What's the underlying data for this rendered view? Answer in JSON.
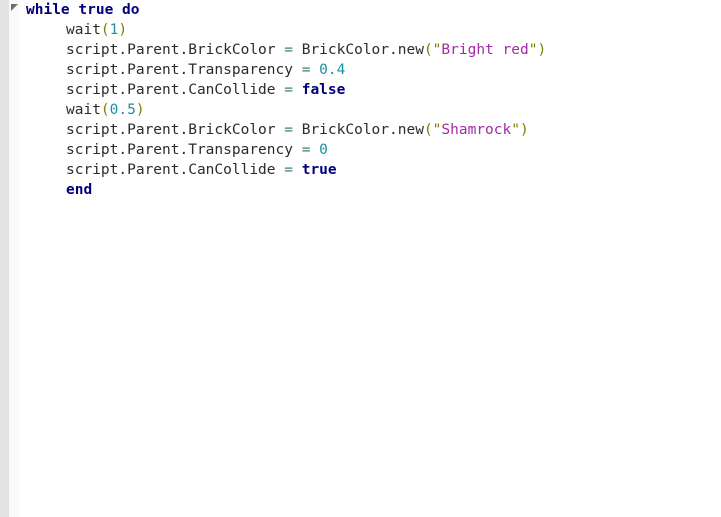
{
  "editor": {
    "language": "Lua",
    "gutter": {
      "fold_marker": "collapse-triangle"
    },
    "colors": {
      "keyword": "#00007f",
      "string": "#a52aa5",
      "number": "#1a8fa0",
      "punctuation": "#7f7f00",
      "operator": "#3f7f7f",
      "plain_text": "#2b2b2b",
      "background": "#ffffff",
      "gutter_band": "#e3e3e3",
      "gutter_strip": "#fafafa"
    },
    "lines": [
      {
        "indent": 0,
        "tokens": [
          {
            "t": "while",
            "c": "kw"
          },
          {
            "t": " ",
            "c": "plain"
          },
          {
            "t": "true",
            "c": "kw"
          },
          {
            "t": " ",
            "c": "plain"
          },
          {
            "t": "do",
            "c": "kw"
          }
        ]
      },
      {
        "indent": 1,
        "tokens": [
          {
            "t": "wait",
            "c": "plain"
          },
          {
            "t": "(",
            "c": "punct"
          },
          {
            "t": "1",
            "c": "num"
          },
          {
            "t": ")",
            "c": "punct"
          }
        ]
      },
      {
        "indent": 1,
        "tokens": [
          {
            "t": "script.Parent.BrickColor ",
            "c": "plain"
          },
          {
            "t": "=",
            "c": "op"
          },
          {
            "t": " BrickColor.new",
            "c": "plain"
          },
          {
            "t": "(",
            "c": "punct"
          },
          {
            "t": "\"",
            "c": "punct"
          },
          {
            "t": "Bright red",
            "c": "str"
          },
          {
            "t": "\"",
            "c": "punct"
          },
          {
            "t": ")",
            "c": "punct"
          }
        ]
      },
      {
        "indent": 1,
        "tokens": [
          {
            "t": "script.Parent.Transparency ",
            "c": "plain"
          },
          {
            "t": "=",
            "c": "op"
          },
          {
            "t": " ",
            "c": "plain"
          },
          {
            "t": "0.4",
            "c": "num"
          }
        ]
      },
      {
        "indent": 1,
        "tokens": [
          {
            "t": "script.Parent.CanCollide ",
            "c": "plain"
          },
          {
            "t": "=",
            "c": "op"
          },
          {
            "t": " ",
            "c": "plain"
          },
          {
            "t": "false",
            "c": "kw"
          }
        ]
      },
      {
        "indent": 1,
        "tokens": [
          {
            "t": "wait",
            "c": "plain"
          },
          {
            "t": "(",
            "c": "punct"
          },
          {
            "t": "0.5",
            "c": "num"
          },
          {
            "t": ")",
            "c": "punct"
          }
        ]
      },
      {
        "indent": 1,
        "tokens": [
          {
            "t": "script.Parent.BrickColor ",
            "c": "plain"
          },
          {
            "t": "=",
            "c": "op"
          },
          {
            "t": " BrickColor.new",
            "c": "plain"
          },
          {
            "t": "(",
            "c": "punct"
          },
          {
            "t": "\"",
            "c": "punct"
          },
          {
            "t": "Shamrock",
            "c": "str"
          },
          {
            "t": "\"",
            "c": "punct"
          },
          {
            "t": ")",
            "c": "punct"
          }
        ]
      },
      {
        "indent": 1,
        "tokens": [
          {
            "t": "script.Parent.Transparency ",
            "c": "plain"
          },
          {
            "t": "=",
            "c": "op"
          },
          {
            "t": " ",
            "c": "plain"
          },
          {
            "t": "0",
            "c": "num"
          }
        ]
      },
      {
        "indent": 1,
        "tokens": [
          {
            "t": "script.Parent.CanCollide ",
            "c": "plain"
          },
          {
            "t": "=",
            "c": "op"
          },
          {
            "t": " ",
            "c": "plain"
          },
          {
            "t": "true",
            "c": "kw"
          }
        ]
      },
      {
        "indent": 1,
        "tokens": [
          {
            "t": "end",
            "c": "kw"
          }
        ]
      }
    ]
  }
}
